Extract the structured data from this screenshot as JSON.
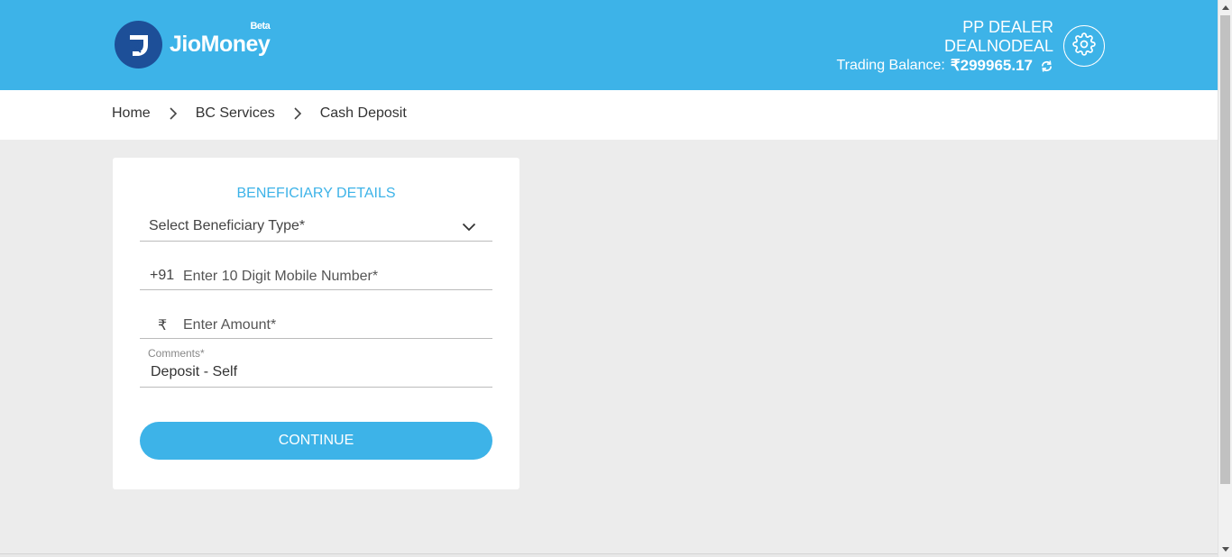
{
  "header": {
    "logo_text": "JioMoney",
    "logo_badge": "Beta",
    "user_line1": "PP DEALER",
    "user_line2": "DEALNODEAL",
    "balance_label": "Trading Balance:",
    "balance_value": "₹299965.17",
    "icons": [
      "rupee-logo-icon",
      "refresh-icon",
      "gear-icon"
    ],
    "bg_color": "#3db3e8",
    "logo_color": "#1d4f98"
  },
  "breadcrumb": [
    "Home",
    "BC Services",
    "Cash Deposit"
  ],
  "form": {
    "title": "BENEFICIARY DETAILS",
    "beneficiary_type_placeholder": "Select Beneficiary Type*",
    "mobile_prefix": "+91",
    "mobile_placeholder": "Enter 10 Digit Mobile Number*",
    "amount_prefix": "₹",
    "amount_placeholder": "Enter Amount*",
    "comments_label": "Comments*",
    "comments_value": "Deposit - Self",
    "continue_label": "CONTINUE",
    "accent_color": "#3db3e8"
  }
}
